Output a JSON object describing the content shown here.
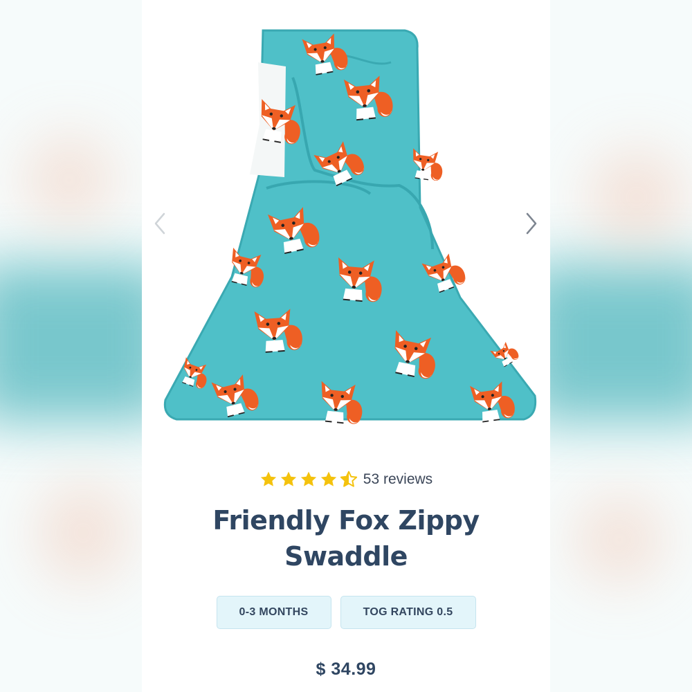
{
  "product": {
    "title_line1": "Friendly Fox Zippy",
    "title_line2": "Swaddle",
    "rating": 4.5,
    "reviews_label": "53 reviews",
    "price": "$ 34.99",
    "badges": [
      "0-3 MONTHS",
      "TOG RATING 0.5"
    ]
  },
  "gallery": {
    "prev_icon": "chevron-left-icon",
    "next_icon": "chevron-right-icon",
    "image_subject": "swaddle-product-photo"
  },
  "colors": {
    "fabric": "#4fc0c8",
    "fox": "#ee5f24",
    "title_text": "#2f4662",
    "star": "#f4c20d",
    "badge_bg": "#e3f5fa"
  }
}
